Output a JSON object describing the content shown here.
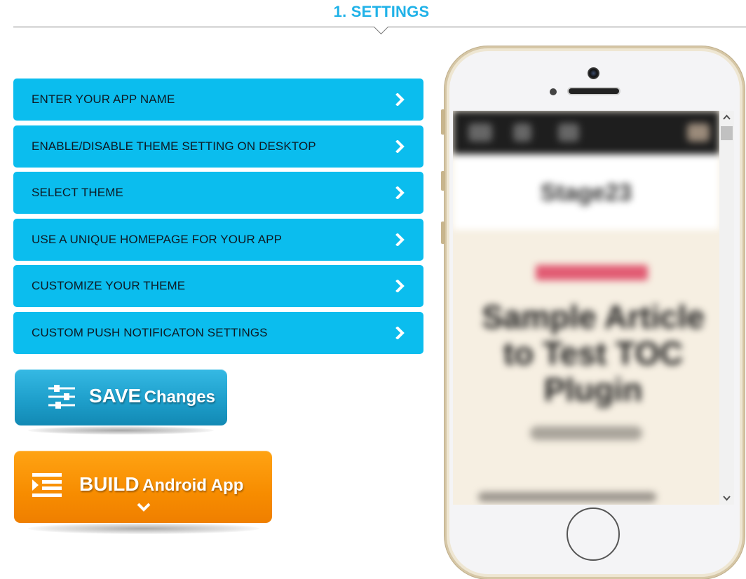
{
  "heading": "1. SETTINGS",
  "menu": {
    "items": [
      {
        "label": "ENTER YOUR APP NAME"
      },
      {
        "label": "ENABLE/DISABLE THEME SETTING ON DESKTOP"
      },
      {
        "label": "SELECT THEME"
      },
      {
        "label": "USE A UNIQUE HOMEPAGE FOR YOUR APP"
      },
      {
        "label": "CUSTOMIZE YOUR THEME"
      },
      {
        "label": "CUSTOM PUSH NOTIFICATON SETTINGS"
      }
    ],
    "chevron_icon": "chevron-right-icon"
  },
  "save_button": {
    "strong": "SAVE",
    "rest": "Changes",
    "icon": "sliders-icon",
    "color": "#1e9fcb"
  },
  "build_button": {
    "strong": "BUILD",
    "rest": "Android App",
    "icon": "indent-list-icon",
    "arrow_icon": "chevron-down-icon",
    "color": "#f78c00"
  },
  "preview": {
    "logo": "Stage23",
    "title": "Sample Article to Test TOC Plugin"
  },
  "colors": {
    "accent": "#20b2e8",
    "menu_bg": "#0bbdee"
  }
}
